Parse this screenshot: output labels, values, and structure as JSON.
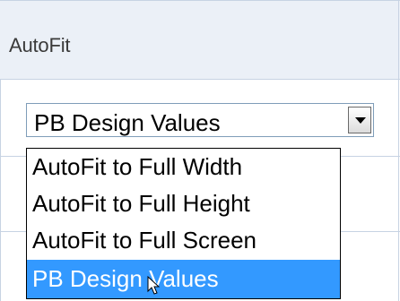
{
  "section": {
    "title": "AutoFit"
  },
  "autofit_select": {
    "selected_value": "PB Design Values",
    "options": [
      "AutoFit to Full Width",
      "AutoFit to Full Height",
      "AutoFit to Full Screen",
      "PB Design Values"
    ],
    "highlighted_index": 3
  },
  "colors": {
    "header_bg": "#ebf0f7",
    "grid_line": "#c7d3e3",
    "highlight": "#3399ff"
  }
}
